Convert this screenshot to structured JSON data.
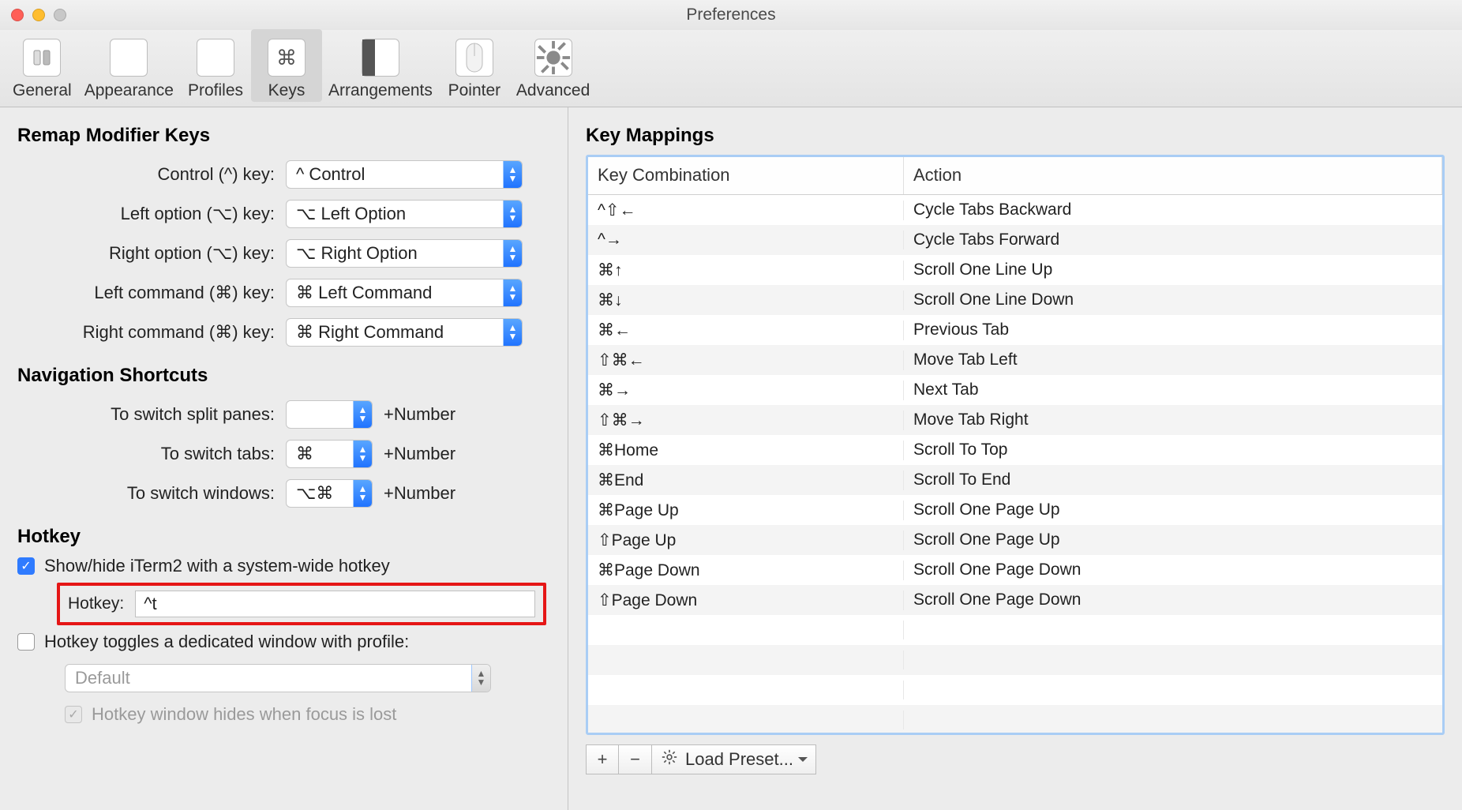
{
  "window": {
    "title": "Preferences"
  },
  "toolbar": {
    "items": [
      {
        "label": "General"
      },
      {
        "label": "Appearance"
      },
      {
        "label": "Profiles"
      },
      {
        "label": "Keys"
      },
      {
        "label": "Arrangements"
      },
      {
        "label": "Pointer"
      },
      {
        "label": "Advanced"
      }
    ],
    "selected": "Keys",
    "keys_glyph": "⌘"
  },
  "left": {
    "remap_heading": "Remap Modifier Keys",
    "modifiers": [
      {
        "label": "Control (^) key:",
        "value": "^ Control"
      },
      {
        "label": "Left option (⌥) key:",
        "value": "⌥ Left Option"
      },
      {
        "label": "Right option (⌥) key:",
        "value": "⌥ Right Option"
      },
      {
        "label": "Left command (⌘) key:",
        "value": "⌘ Left Command"
      },
      {
        "label": "Right command (⌘) key:",
        "value": "⌘ Right Command"
      }
    ],
    "nav_heading": "Navigation Shortcuts",
    "nav": [
      {
        "label": "To switch split panes:",
        "value": "",
        "suffix": "+Number"
      },
      {
        "label": "To switch tabs:",
        "value": "⌘",
        "suffix": "+Number"
      },
      {
        "label": "To switch windows:",
        "value": "⌥⌘",
        "suffix": "+Number"
      }
    ],
    "hotkey_heading": "Hotkey",
    "hotkey": {
      "show_hide_label": "Show/hide iTerm2 with a system-wide hotkey",
      "show_hide_checked": true,
      "field_label": "Hotkey:",
      "field_value": "^t",
      "dedicated_label": "Hotkey toggles a dedicated window with profile:",
      "dedicated_checked": false,
      "profile_value": "Default",
      "hides_label": "Hotkey window hides when focus is lost",
      "hides_checked": true
    }
  },
  "right": {
    "heading": "Key Mappings",
    "columns": {
      "kc": "Key Combination",
      "ac": "Action"
    },
    "rows": [
      {
        "kc": "^⇧←",
        "ac": "Cycle Tabs Backward"
      },
      {
        "kc": "^→",
        "ac": "Cycle Tabs Forward"
      },
      {
        "kc": "⌘↑",
        "ac": "Scroll One Line Up"
      },
      {
        "kc": "⌘↓",
        "ac": "Scroll One Line Down"
      },
      {
        "kc": "⌘←",
        "ac": "Previous Tab"
      },
      {
        "kc": "⇧⌘←",
        "ac": "Move Tab Left"
      },
      {
        "kc": "⌘→",
        "ac": "Next Tab"
      },
      {
        "kc": "⇧⌘→",
        "ac": "Move Tab Right"
      },
      {
        "kc": "⌘Home",
        "ac": "Scroll To Top"
      },
      {
        "kc": "⌘End",
        "ac": "Scroll To End"
      },
      {
        "kc": "⌘Page Up",
        "ac": "Scroll One Page Up"
      },
      {
        "kc": "⇧Page Up",
        "ac": "Scroll One Page Up"
      },
      {
        "kc": "⌘Page Down",
        "ac": "Scroll One Page Down"
      },
      {
        "kc": "⇧Page Down",
        "ac": "Scroll One Page Down"
      }
    ],
    "empty_rows": 4,
    "controls": {
      "add": "+",
      "remove": "−",
      "gear": "✱",
      "preset_label": "Load Preset..."
    }
  }
}
